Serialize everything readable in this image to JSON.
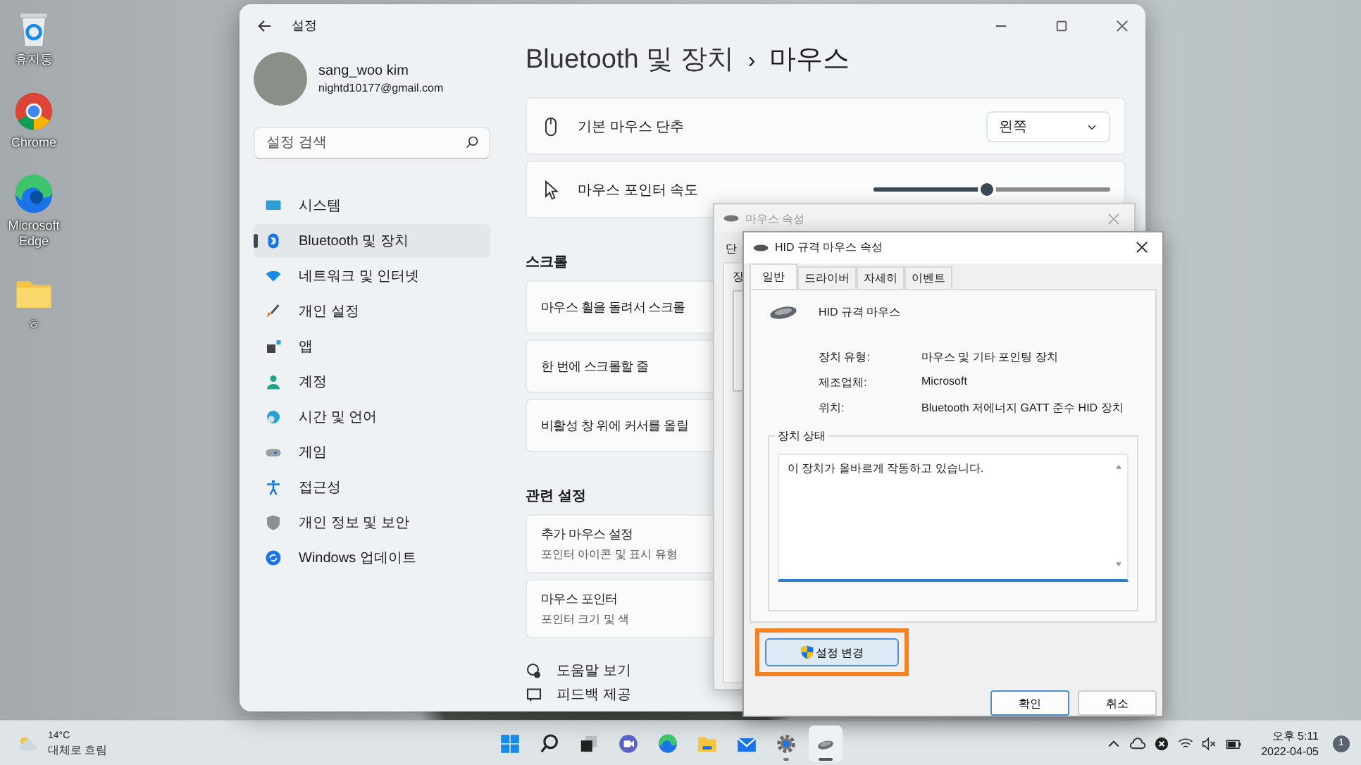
{
  "desktop_icons": [
    {
      "label": "휴지통",
      "kind": "recycle-bin"
    },
    {
      "label": "Chrome",
      "kind": "chrome"
    },
    {
      "label": "Microsoft Edge",
      "kind": "edge"
    },
    {
      "label": "ㅎ",
      "kind": "folder"
    }
  ],
  "settings": {
    "title": "설정",
    "user": {
      "name": "sang_woo kim",
      "email": "nightd10177@gmail.com"
    },
    "search": {
      "placeholder": "설정 검색"
    },
    "nav": [
      {
        "label": "시스템",
        "kind": "system",
        "selected": false
      },
      {
        "label": "Bluetooth 및 장치",
        "kind": "bluetooth",
        "selected": true
      },
      {
        "label": "네트워크 및 인터넷",
        "kind": "network",
        "selected": false
      },
      {
        "label": "개인 설정",
        "kind": "personalization",
        "selected": false
      },
      {
        "label": "앱",
        "kind": "apps",
        "selected": false
      },
      {
        "label": "계정",
        "kind": "accounts",
        "selected": false
      },
      {
        "label": "시간 및 언어",
        "kind": "time",
        "selected": false
      },
      {
        "label": "게임",
        "kind": "gaming",
        "selected": false
      },
      {
        "label": "접근성",
        "kind": "accessibility",
        "selected": false
      },
      {
        "label": "개인 정보 및 보안",
        "kind": "privacy",
        "selected": false
      },
      {
        "label": "Windows 업데이트",
        "kind": "update",
        "selected": false
      }
    ],
    "breadcrumb": {
      "parent": "Bluetooth 및 장치",
      "separator": "›",
      "current": "마우스"
    },
    "rows": [
      {
        "kind": "dropdown",
        "label": "기본 마우스 단추",
        "value": "왼쪽"
      },
      {
        "kind": "slider",
        "label": "마우스 포인터 속도",
        "level": 0.48
      }
    ],
    "sections": [
      {
        "title": "스크롤",
        "cards": [
          {
            "label": "마우스 휠을 돌려서 스크롤"
          },
          {
            "label": "한 번에 스크롤할 줄"
          },
          {
            "label": "비활성 창 위에 커서를 올릴"
          }
        ]
      },
      {
        "title": "관련 설정",
        "cards": [
          {
            "label": "추가 마우스 설정",
            "description": "포인터 아이콘 및 표시 유형"
          },
          {
            "label": "마우스 포인터",
            "description": "포인터 크기 및 색"
          }
        ]
      }
    ],
    "links": [
      {
        "label": "도움말 보기",
        "kind": "help"
      },
      {
        "label": "피드백 제공",
        "kind": "feedback"
      }
    ]
  },
  "mouse_properties_dialog": {
    "title": "마우스 속성",
    "tab": "단",
    "group_label": "장"
  },
  "hid_dialog": {
    "title": "HID 규격 마우스 속성",
    "tabs": [
      {
        "label": "일반",
        "selected": true
      },
      {
        "label": "드라이버",
        "selected": false
      },
      {
        "label": "자세히",
        "selected": false
      },
      {
        "label": "이벤트",
        "selected": false
      }
    ],
    "device_name": "HID 규격 마우스",
    "properties": [
      {
        "label": "장치 유형:",
        "value": "마우스 및 기타 포인팅 장치"
      },
      {
        "label": "제조업체:",
        "value": "Microsoft"
      },
      {
        "label": "위치:",
        "value": "Bluetooth 저에너지 GATT 준수 HID 장치"
      }
    ],
    "status_group": "장치 상태",
    "status_text": "이 장치가 올바르게 작동하고 있습니다.",
    "change_button": {
      "label": "설정 변경",
      "highlighted": true
    },
    "buttons": [
      "확인",
      "취소"
    ]
  },
  "taskbar": {
    "weather": {
      "temp": "14°C",
      "text": "대체로 흐림"
    },
    "apps": [
      {
        "kind": "start",
        "running": false,
        "active": false
      },
      {
        "kind": "search",
        "running": false,
        "active": false
      },
      {
        "kind": "taskview",
        "running": false,
        "active": false
      },
      {
        "kind": "chat",
        "running": false,
        "active": false
      },
      {
        "kind": "edge",
        "running": false,
        "active": false
      },
      {
        "kind": "explorer",
        "running": false,
        "active": false
      },
      {
        "kind": "mail",
        "running": false,
        "active": false
      },
      {
        "kind": "settings",
        "running": true,
        "active": false
      },
      {
        "kind": "mouse",
        "running": true,
        "active": true
      }
    ],
    "time": "오후 5:11",
    "date": "2022-04-05",
    "notifications": "1"
  }
}
